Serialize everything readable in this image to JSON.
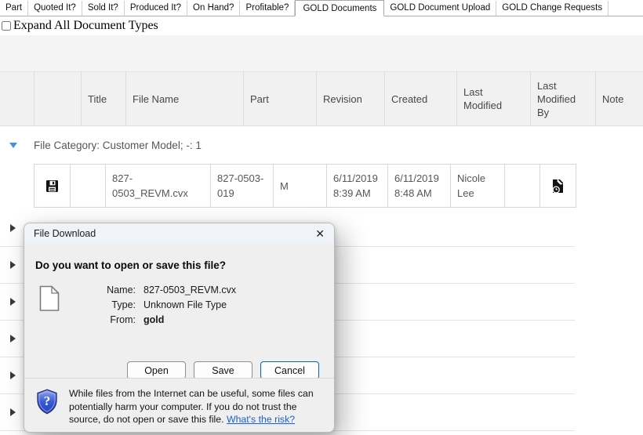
{
  "tabs": {
    "items": [
      {
        "label": "Part",
        "active": false
      },
      {
        "label": "Quoted It?",
        "active": false
      },
      {
        "label": "Sold It?",
        "active": false
      },
      {
        "label": "Produced It?",
        "active": false
      },
      {
        "label": "On Hand?",
        "active": false
      },
      {
        "label": "Profitable?",
        "active": false
      },
      {
        "label": "GOLD Documents",
        "active": true
      },
      {
        "label": "GOLD Document Upload",
        "active": false
      },
      {
        "label": "GOLD Change Requests",
        "active": false
      }
    ]
  },
  "filters": {
    "expand_all_label": "Expand All Document Types",
    "checked": false
  },
  "grid": {
    "headers": [
      "",
      "",
      "Title",
      "File Name",
      "Part",
      "Revision",
      "Created",
      "Last Modified",
      "Last Modified By",
      "Note"
    ],
    "category_label": "File Category: Customer Model; -: 1",
    "row": {
      "title": "",
      "file_name": "827-0503_REVM.cvx",
      "part": "827-0503-019",
      "revision": "M",
      "created": "6/11/2019 8:39 AM",
      "last_modified": "6/11/2019 8:48 AM",
      "last_modified_by": "Nicole Lee",
      "note": ""
    },
    "collapsed_row_count": 6,
    "icons": {
      "save": "floppy-disk-icon",
      "note": "document-history-icon",
      "expanded": "triangle-down-icon",
      "collapsed": "triangle-right-icon"
    }
  },
  "dialog": {
    "title": "File Download",
    "close_glyph": "✕",
    "heading": "Do you want to open or save this file?",
    "name_label": "Name:",
    "name_value": "827-0503_REVM.cvx",
    "type_label": "Type:",
    "type_value": "Unknown File Type",
    "from_label": "From:",
    "from_value": "gold",
    "open_label": "Open",
    "save_label": "Save",
    "cancel_label": "Cancel",
    "warning_text": "While files from the Internet can be useful, some files can potentially harm your computer. If you do not trust the source, do not open or save this file.",
    "risk_link_label": "What's the risk?",
    "colors": {
      "accent": "#0067b8",
      "link": "#1c5fd1",
      "category_arrow": "#4a90d9"
    }
  }
}
